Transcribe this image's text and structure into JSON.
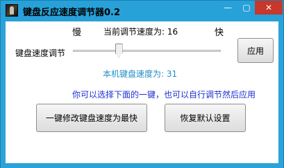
{
  "window": {
    "title": "键盘反应速度调节器0.2",
    "minimize_glyph": "—",
    "maximize_glyph": "▢",
    "close_glyph": "✕"
  },
  "speed": {
    "slow_label": "慢",
    "fast_label": "快",
    "current_text": "当前调节速度为: 16",
    "adjust_label": "键盘速度调节",
    "slider_value_fraction": 0.31,
    "machine_text": "本机键盘速度为: 31"
  },
  "hint": "你可以选择下面的一键，也可以自行调节然后应用",
  "buttons": {
    "apply": "应用",
    "max_speed": "一键修改键盘速度为最快",
    "reset": "恢复默认设置"
  },
  "colors": {
    "frame": "#2aa3d9",
    "machine_text": "#1f8fc8",
    "hint_text": "#1c2fd0",
    "close_button": "#c7372b"
  }
}
